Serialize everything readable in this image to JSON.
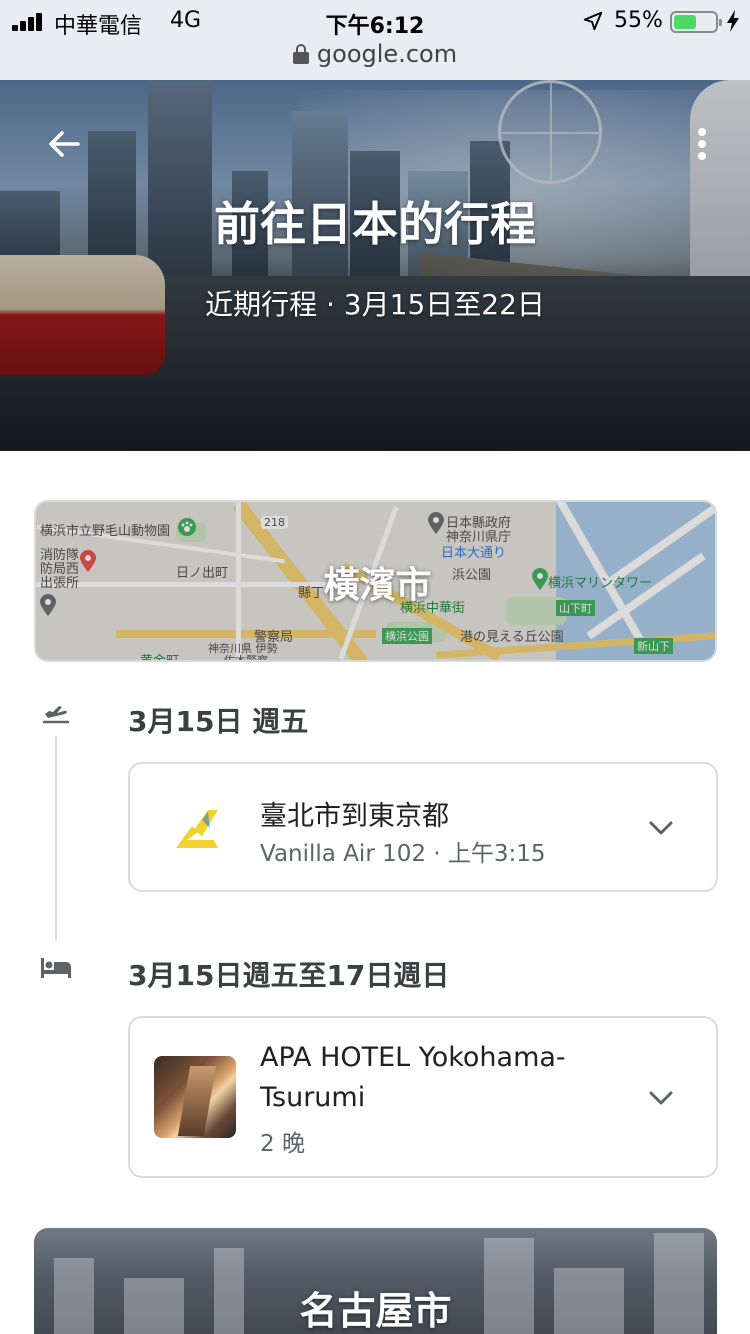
{
  "status_bar": {
    "carrier": "中華電信",
    "network": "4G",
    "time": "下午6:12",
    "battery_percent": "55%",
    "battery_level": 0.55
  },
  "url_bar": {
    "domain": "google.com"
  },
  "hero": {
    "title": "前往日本的行程",
    "subtitle": "近期行程 · 3月15日至22日"
  },
  "map_card": {
    "city": "橫濱市",
    "map_labels": [
      "横浜市立野毛山動物園",
      "消防隊",
      "防局西",
      "出張所",
      "日ノ出町",
      "218",
      "日本縣政府",
      "神奈川県庁",
      "日本大通り",
      "浜公園",
      "横浜マリンタワー",
      "横浜中華街",
      "山下町",
      "警察局",
      "神奈川県 伊勢",
      "佐木警察",
      "黄金町",
      "横浜公園",
      "港の見える丘公園",
      "新山下",
      "縣丁"
    ]
  },
  "timeline": {
    "flight_day": "3月15日 週五",
    "flight": {
      "title": "臺北市到東京都",
      "detail": "Vanilla Air 102 · 上午3:15"
    },
    "hotel_days": "3月15日週五至17日週日",
    "hotel": {
      "name_line1": "APA HOTEL Yokohama-",
      "name_line2": "Tsurumi",
      "nights": "2 晚"
    }
  },
  "next_city_card": {
    "city": "名古屋市"
  },
  "colors": {
    "status_bg": "#e9edf2",
    "battery_green": "#4cd964",
    "card_border": "#dadce0",
    "secondary_text": "#5f6368",
    "vanilla_yellow": "#f2d22e"
  }
}
